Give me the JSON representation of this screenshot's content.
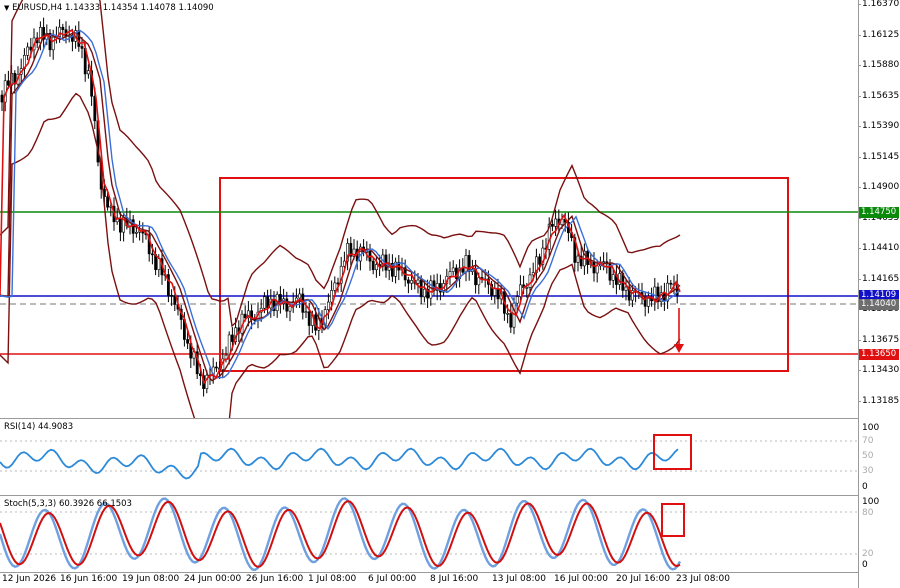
{
  "main": {
    "title": "EURUSD,H4  1.14333 1.14354 1.14078 1.14090",
    "price_labels": [
      "1.16370",
      "1.16125",
      "1.15880",
      "1.15635",
      "1.15390",
      "1.15145",
      "1.14900",
      "1.14655",
      "1.14410",
      "1.14165",
      "1.13920",
      "1.13675",
      "1.13430",
      "1.13185"
    ],
    "tags": {
      "resistance": {
        "text": "1.14750",
        "color": "#0a8a0a"
      },
      "current": {
        "text": "1.14109",
        "color": "#1010c8"
      },
      "bid": {
        "text": "1.14040",
        "color": "#6e6e6e"
      },
      "support": {
        "text": "1.13650",
        "color": "#e01010"
      }
    }
  },
  "rsi": {
    "title": "RSI(14) 44.9083",
    "levels": [
      "100",
      "70",
      "50",
      "30",
      "0"
    ]
  },
  "stoch": {
    "title": "Stoch(5,3,3) 60.3926 66.1503",
    "levels": [
      "100",
      "80",
      "20",
      "0"
    ]
  },
  "time_labels": [
    "12 Jun 2026",
    "16 Jun 16:00",
    "19 Jun 08:00",
    "24 Jun 00:00",
    "26 Jun 16:00",
    "1 Jul 08:00",
    "6 Jul 00:00",
    "8 Jul 16:00",
    "13 Jul 08:00",
    "16 Jul 00:00",
    "20 Jul 16:00",
    "23 Jul 08:00"
  ],
  "colors": {
    "candles": "#000000",
    "bollinger": "#7a1010",
    "ma_fast": "#e01010",
    "ma_slow": "#3a6fd8",
    "rsi_line": "#2d8ad8",
    "stoch_main": "#6fa0e0",
    "stoch_signal": "#d01010",
    "annotation": "#e01010",
    "support": "#e01010",
    "resistance": "#0a8a0a",
    "current": "#1010c8"
  },
  "icons": {
    "dropdown": "triangle-down-icon",
    "arrow": "arrow-down-icon"
  }
}
